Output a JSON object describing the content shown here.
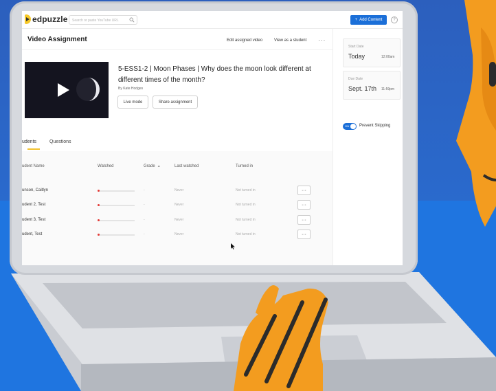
{
  "app": {
    "name": "edpuzzle",
    "search_placeholder": "Search or paste YouTube URL",
    "add_content_label": "Add Content",
    "help_icon": "?",
    "colors": {
      "accent": "#1b6fd8",
      "brand": "#f7c928",
      "progress": "#e53935"
    }
  },
  "page": {
    "title": "Video Assignment",
    "actions": [
      "Edit assigned video",
      "View as a student"
    ],
    "more_label": "···"
  },
  "video": {
    "title": "5-ESS1-2 | Moon Phases | Why does the moon look different at different times of the month?",
    "author": "By Kate Hodges",
    "live_mode_label": "Live mode",
    "share_label": "Share assignment"
  },
  "tabs": [
    {
      "label": "udents",
      "active": true
    },
    {
      "label": "Questions",
      "active": false
    }
  ],
  "table": {
    "headers": [
      "udent Name",
      "Watched",
      "Grade",
      "Last watched",
      "Turned in"
    ],
    "rows": [
      {
        "name": "unson, Caitlyn",
        "watched": 0.02,
        "grade": "-",
        "last_watched": "Never",
        "turned_in": "Not turned in",
        "menu": "···"
      },
      {
        "name": "udent 2, Test",
        "watched": 0.02,
        "grade": "-",
        "last_watched": "Never",
        "turned_in": "Not turned in",
        "menu": "···"
      },
      {
        "name": "udent 3, Test",
        "watched": 0.02,
        "grade": "-",
        "last_watched": "Never",
        "turned_in": "Not turned in",
        "menu": "···"
      },
      {
        "name": "udent, Test",
        "watched": 0.02,
        "grade": "-",
        "last_watched": "Never",
        "turned_in": "Not turned in",
        "menu": "···"
      }
    ]
  },
  "sidebar": {
    "start": {
      "label": "Start Date",
      "value": "Today",
      "time": "12:00am"
    },
    "due": {
      "label": "Due Date",
      "value": "Sept. 17th",
      "time": "11:59pm"
    },
    "toggle": {
      "state": "on",
      "on_text": "ON",
      "label": "Prevent Skipping"
    }
  }
}
